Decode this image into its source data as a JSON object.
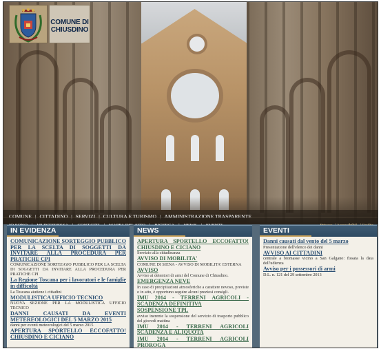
{
  "header": {
    "title_line1": "COMUNE DI",
    "title_line2": "CHIUSDINO"
  },
  "topnav": {
    "items": [
      "COMUNE",
      "CITTADINO",
      "SERVIZI",
      "CULTURA E TURISMO",
      "AMMINISTRAZIONE TRASPARENTE"
    ]
  },
  "subnav": {
    "items": [
      "IO SONO",
      "MI INTERESSA",
      "CONTATTI",
      "MAPPA DEL SITO",
      "RICERCA",
      "NEWS",
      "EVENTI"
    ],
    "right": [
      "Privacy",
      "Accessibilità",
      "Credits"
    ]
  },
  "in_evidenza": {
    "heading": "IN EVIDENZA",
    "items": [
      {
        "title": "COMUNICAZIONE SORTEGGIO PUBBLICO PER LA SCELTA DI SOGGETTI DA INVITARE ALLA PROCEDURA PER PRATICHE CPI",
        "desc": "COMUNICAZIONE SORTEGGIO PUBBLICO PER LA SCELTA DI SOGGETTI DA INVITARE ALLA PROCEDURA PER PRATICHE CPI"
      },
      {
        "title": "La Regione Toscana per i lavoratori e le famiglie in difficoltà",
        "desc": "La Toscana aiutiene i cittadini"
      },
      {
        "title": "MODULISTICA UFFICIO TECNICO",
        "desc": "NUOVA SEZIONE PER LA MODULISTICA UFFICIO TECNICO"
      },
      {
        "title": "DANNI CAUSATI DA EVENTI METEREOLOGICI DEL 5 MARZO 2015",
        "desc": "danni per eventi meteorologici del 5 marzo 2015"
      },
      {
        "title": "APERTURA SPORTELLO ECCOFATTO! CHIUSDINO E CICIANO",
        "desc": ""
      }
    ]
  },
  "news": {
    "heading": "NEWS",
    "items": [
      {
        "title": "APERTURA SPORTELLO ECCOFATTO! CHIUSDINO E CICIANO",
        "desc": "Servizio alla cittadinanza"
      },
      {
        "title": "AVVISO DI MOBILITA'",
        "desc": "COMUNE DI SIENA - AVVISO DI MOBILITA' ESTERNA"
      },
      {
        "title": "AVVISO",
        "desc": "Avviso ai detentori di armi del Comune di Chiusdino."
      },
      {
        "title": "EMERGENZA NEVE",
        "desc": "In caso di precipitazioni atmosferiche a carattere nevoso, previste o in atto, è opportuno seguire alcuni preziosi consigli."
      },
      {
        "title": "IMU 2014 - TERRENI AGRICOLI - SCADENZA DEFINITIVA",
        "desc": ""
      },
      {
        "title": "SOSPENSIONE TPL",
        "desc": "avviso inerente la sospensione del servizio di trasporto pubblico del giovedì mattina"
      },
      {
        "title": "IMU 2014 - TERRENI AGRICOLI SCADENZA E ALIQUOTA",
        "desc": ""
      },
      {
        "title": "IMU 2014 - TERRENI AGRICOLI PROROGA",
        "desc": ""
      }
    ]
  },
  "eventi": {
    "heading": "EVENTI",
    "items": [
      {
        "title": "Danni causati dal vento del 5 marzo",
        "desc": "Presentazione dell'elenco dei danni"
      },
      {
        "title": "AVVISO AI CITTADINI",
        "desc": "centrale a biomasse vicino a San Galgano: fissata la data dell'udienza"
      },
      {
        "title": "Avviso per i possessori di armi",
        "desc": "D.L. n. 121 del 29 settembre 2013"
      }
    ]
  }
}
